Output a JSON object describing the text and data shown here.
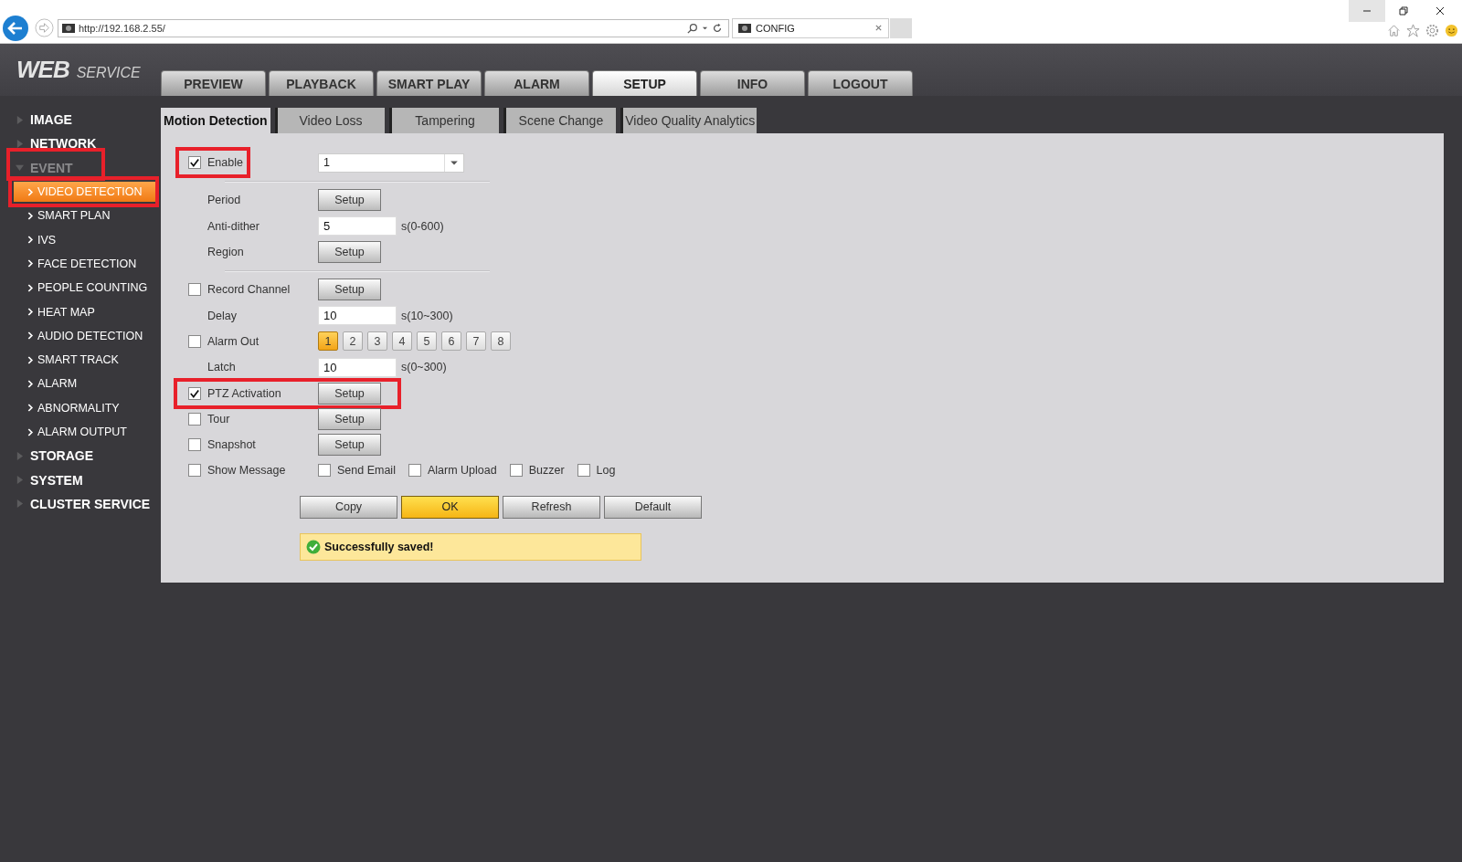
{
  "browser": {
    "url": "http://192.168.2.55/",
    "tab_title": "CONFIG"
  },
  "logo": {
    "main": "WEB",
    "sub": "SERVICE"
  },
  "nav": [
    {
      "label": "PREVIEW",
      "selected": false
    },
    {
      "label": "PLAYBACK",
      "selected": false
    },
    {
      "label": "SMART PLAY",
      "selected": false
    },
    {
      "label": "ALARM",
      "selected": false
    },
    {
      "label": "SETUP",
      "selected": true
    },
    {
      "label": "INFO",
      "selected": false
    },
    {
      "label": "LOGOUT",
      "selected": false
    }
  ],
  "sidebar": [
    {
      "label": "IMAGE",
      "expanded": false,
      "highlighted": false
    },
    {
      "label": "NETWORK",
      "expanded": false,
      "highlighted": false
    },
    {
      "label": "EVENT",
      "expanded": true,
      "highlighted": true,
      "children": [
        {
          "label": "VIDEO DETECTION",
          "selected": true,
          "highlighted": true
        },
        {
          "label": "SMART PLAN",
          "selected": false,
          "highlighted": false
        },
        {
          "label": "IVS",
          "selected": false,
          "highlighted": false
        },
        {
          "label": "FACE DETECTION",
          "selected": false,
          "highlighted": false
        },
        {
          "label": "PEOPLE COUNTING",
          "selected": false,
          "highlighted": false
        },
        {
          "label": "HEAT MAP",
          "selected": false,
          "highlighted": false
        },
        {
          "label": "AUDIO DETECTION",
          "selected": false,
          "highlighted": false
        },
        {
          "label": "SMART TRACK",
          "selected": false,
          "highlighted": false
        },
        {
          "label": "ALARM",
          "selected": false,
          "highlighted": false
        },
        {
          "label": "ABNORMALITY",
          "selected": false,
          "highlighted": false
        },
        {
          "label": "ALARM OUTPUT",
          "selected": false,
          "highlighted": false
        }
      ]
    },
    {
      "label": "STORAGE",
      "expanded": false,
      "highlighted": false
    },
    {
      "label": "SYSTEM",
      "expanded": false,
      "highlighted": false
    },
    {
      "label": "CLUSTER SERVICE",
      "expanded": false,
      "highlighted": false
    }
  ],
  "subtabs": [
    {
      "label": "Motion Detection",
      "selected": true
    },
    {
      "label": "Video Loss",
      "selected": false
    },
    {
      "label": "Tampering",
      "selected": false
    },
    {
      "label": "Scene Change",
      "selected": false
    },
    {
      "label": "Video Quality Analytics",
      "selected": false
    }
  ],
  "form": {
    "rows": [
      {
        "kind": "field",
        "label": "Enable",
        "checked": true,
        "highlight": {
          "kind": "label"
        },
        "control": {
          "kind": "select",
          "value": "1"
        }
      },
      {
        "kind": "divider"
      },
      {
        "kind": "field",
        "label": "Period",
        "control": {
          "kind": "button",
          "label": "Setup"
        }
      },
      {
        "kind": "field",
        "label": "Anti-dither",
        "control": {
          "kind": "input",
          "value": "5",
          "hint": "s(0-600)"
        }
      },
      {
        "kind": "field",
        "label": "Region",
        "control": {
          "kind": "button",
          "label": "Setup"
        }
      },
      {
        "kind": "divider"
      },
      {
        "kind": "field",
        "label": "Record Channel",
        "checked": false,
        "control": {
          "kind": "button",
          "label": "Setup"
        }
      },
      {
        "kind": "field",
        "label": "Delay",
        "control": {
          "kind": "input",
          "value": "10",
          "hint": "s(10~300)"
        }
      },
      {
        "kind": "field",
        "label": "Alarm Out",
        "checked": false,
        "control": {
          "kind": "numbers",
          "items": [
            {
              "label": "1",
              "selected": true
            },
            {
              "label": "2",
              "selected": false
            },
            {
              "label": "3",
              "selected": false
            },
            {
              "label": "4",
              "selected": false
            },
            {
              "label": "5",
              "selected": false
            },
            {
              "label": "6",
              "selected": false
            },
            {
              "label": "7",
              "selected": false
            },
            {
              "label": "8",
              "selected": false
            }
          ]
        }
      },
      {
        "kind": "field",
        "label": "Latch",
        "control": {
          "kind": "input",
          "value": "10",
          "hint": "s(0~300)"
        }
      },
      {
        "kind": "field",
        "label": "PTZ Activation",
        "checked": true,
        "highlight": {
          "kind": "row"
        },
        "control": {
          "kind": "button",
          "label": "Setup"
        }
      },
      {
        "kind": "field",
        "label": "Tour",
        "checked": false,
        "control": {
          "kind": "button",
          "label": "Setup"
        }
      },
      {
        "kind": "field",
        "label": "Snapshot",
        "checked": false,
        "control": {
          "kind": "button",
          "label": "Setup"
        }
      },
      {
        "kind": "field",
        "label": "Show Message",
        "checked": false,
        "control": {
          "kind": "checks",
          "items": [
            {
              "label": "Send Email",
              "checked": false
            },
            {
              "label": "Alarm Upload",
              "checked": false
            },
            {
              "label": "Buzzer",
              "checked": false
            },
            {
              "label": "Log",
              "checked": false
            }
          ]
        }
      }
    ],
    "buttons": [
      {
        "label": "Copy",
        "kind": "normal"
      },
      {
        "label": "OK",
        "kind": "primary"
      },
      {
        "label": "Refresh",
        "kind": "normal"
      },
      {
        "label": "Default",
        "kind": "normal"
      }
    ],
    "message": {
      "text": "Successfully saved!",
      "kind": "success"
    }
  }
}
